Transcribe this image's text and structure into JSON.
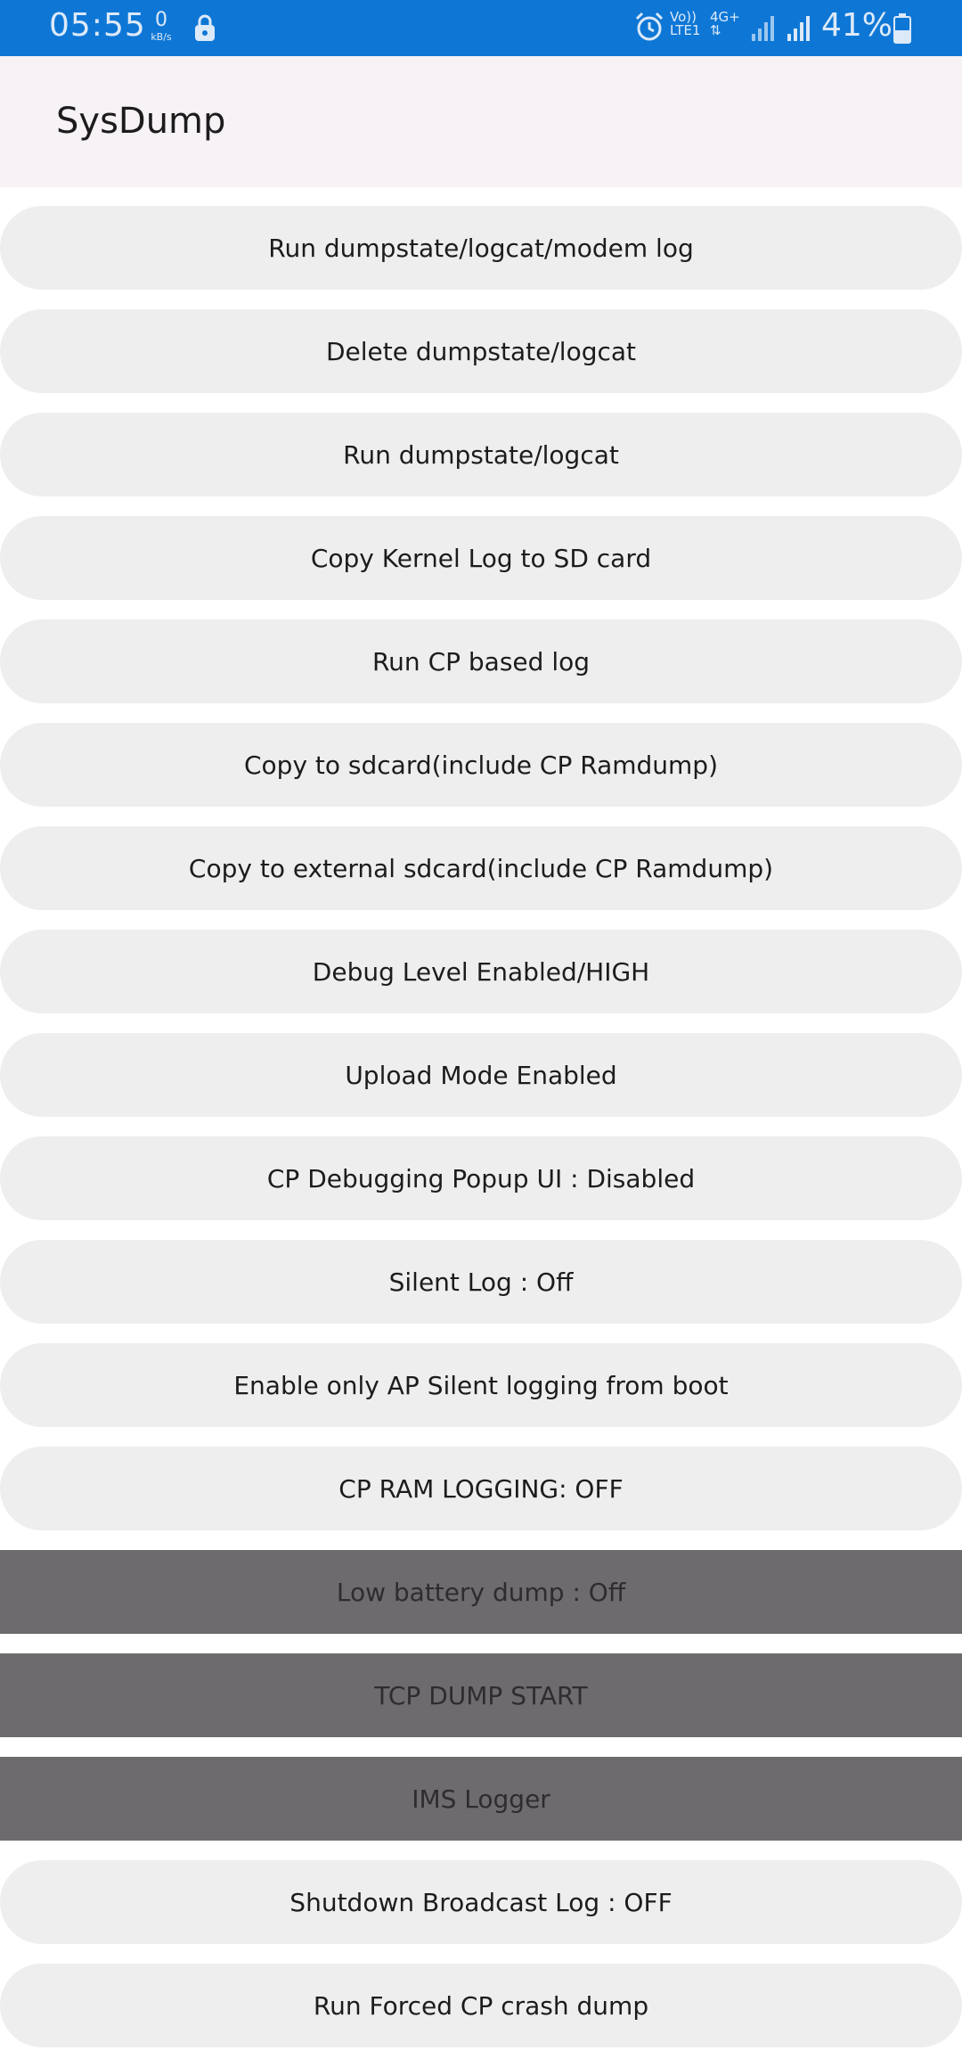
{
  "status_bar": {
    "time": "05:55",
    "net_speed_value": "0",
    "net_speed_unit": "kB/s",
    "volte_label": "Vo))",
    "lte_label": "LTE1",
    "network_type": "4G+",
    "battery_percent": "41%",
    "icons": [
      "lock-icon",
      "alarm-icon",
      "signal-icon",
      "signal-icon",
      "battery-icon"
    ]
  },
  "app_bar": {
    "title": "SysDump"
  },
  "menu": {
    "items": [
      {
        "label": "Run dumpstate/logcat/modem log",
        "enabled": true
      },
      {
        "label": "Delete dumpstate/logcat",
        "enabled": true
      },
      {
        "label": "Run dumpstate/logcat",
        "enabled": true
      },
      {
        "label": "Copy Kernel Log to SD card",
        "enabled": true
      },
      {
        "label": "Run CP based log",
        "enabled": true
      },
      {
        "label": "Copy to sdcard(include CP Ramdump)",
        "enabled": true
      },
      {
        "label": "Copy to external sdcard(include CP Ramdump)",
        "enabled": true
      },
      {
        "label": "Debug Level Enabled/HIGH",
        "enabled": true
      },
      {
        "label": "Upload Mode Enabled",
        "enabled": true
      },
      {
        "label": "CP Debugging Popup UI : Disabled",
        "enabled": true
      },
      {
        "label": "Silent Log : Off",
        "enabled": true
      },
      {
        "label": "Enable only AP Silent logging from boot",
        "enabled": true
      },
      {
        "label": "CP RAM LOGGING: OFF",
        "enabled": true
      },
      {
        "label": "Low battery dump : Off",
        "enabled": false
      },
      {
        "label": "TCP DUMP START",
        "enabled": false
      },
      {
        "label": "IMS Logger",
        "enabled": false
      },
      {
        "label": "Shutdown Broadcast Log : OFF",
        "enabled": true
      },
      {
        "label": "Run Forced CP crash dump",
        "enabled": true
      }
    ]
  },
  "colors": {
    "status_bar_bg": "#0e77d6",
    "app_bar_bg": "#f7f2f5",
    "button_bg": "#eeeeee",
    "button_disabled_bg": "#6d6b6e",
    "text": "#1c1c1c"
  }
}
